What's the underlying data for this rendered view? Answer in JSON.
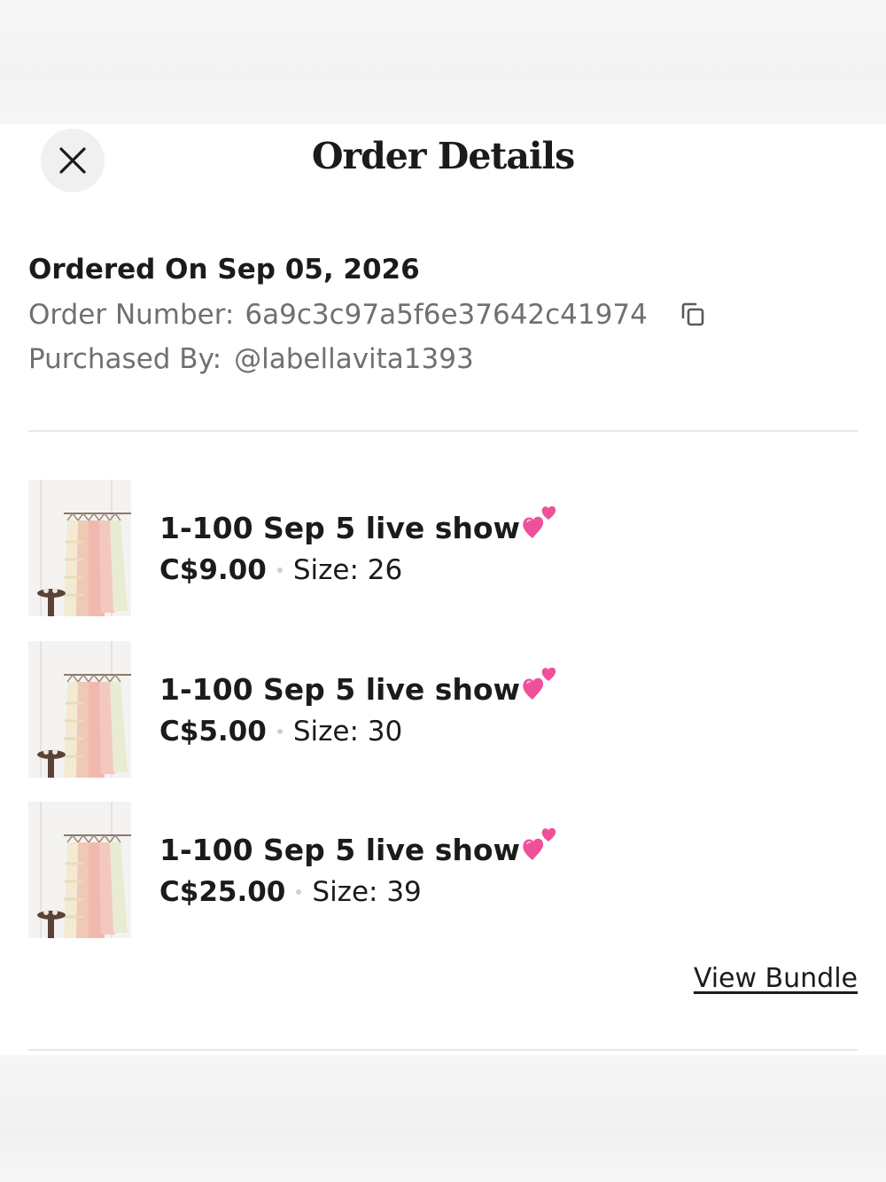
{
  "header": {
    "title": "Order Details",
    "close_icon": "close-icon"
  },
  "order": {
    "ordered_on": "Ordered On Sep 05, 2026",
    "order_number_label": "Order Number:",
    "order_number_value": "6a9c3c97a5f6e37642c41974",
    "copy_icon": "copy-icon",
    "purchased_by_label": "Purchased By:",
    "purchased_by_value": "@labellavita1393"
  },
  "items": [
    {
      "title": "1-100 Sep 5 live show",
      "emoji": "two-hearts-icon",
      "price": "C$9.00",
      "size": "Size: 26"
    },
    {
      "title": "1-100 Sep 5 live show",
      "emoji": "two-hearts-icon",
      "price": "C$5.00",
      "size": "Size: 30"
    },
    {
      "title": "1-100 Sep 5 live show",
      "emoji": "two-hearts-icon",
      "price": "C$25.00",
      "size": "Size: 39"
    }
  ],
  "bundle": {
    "link_label": "View Bundle"
  },
  "colors": {
    "heart_pink": "#f0509a",
    "muted_text": "#707070",
    "divider": "#e6e6e6"
  }
}
